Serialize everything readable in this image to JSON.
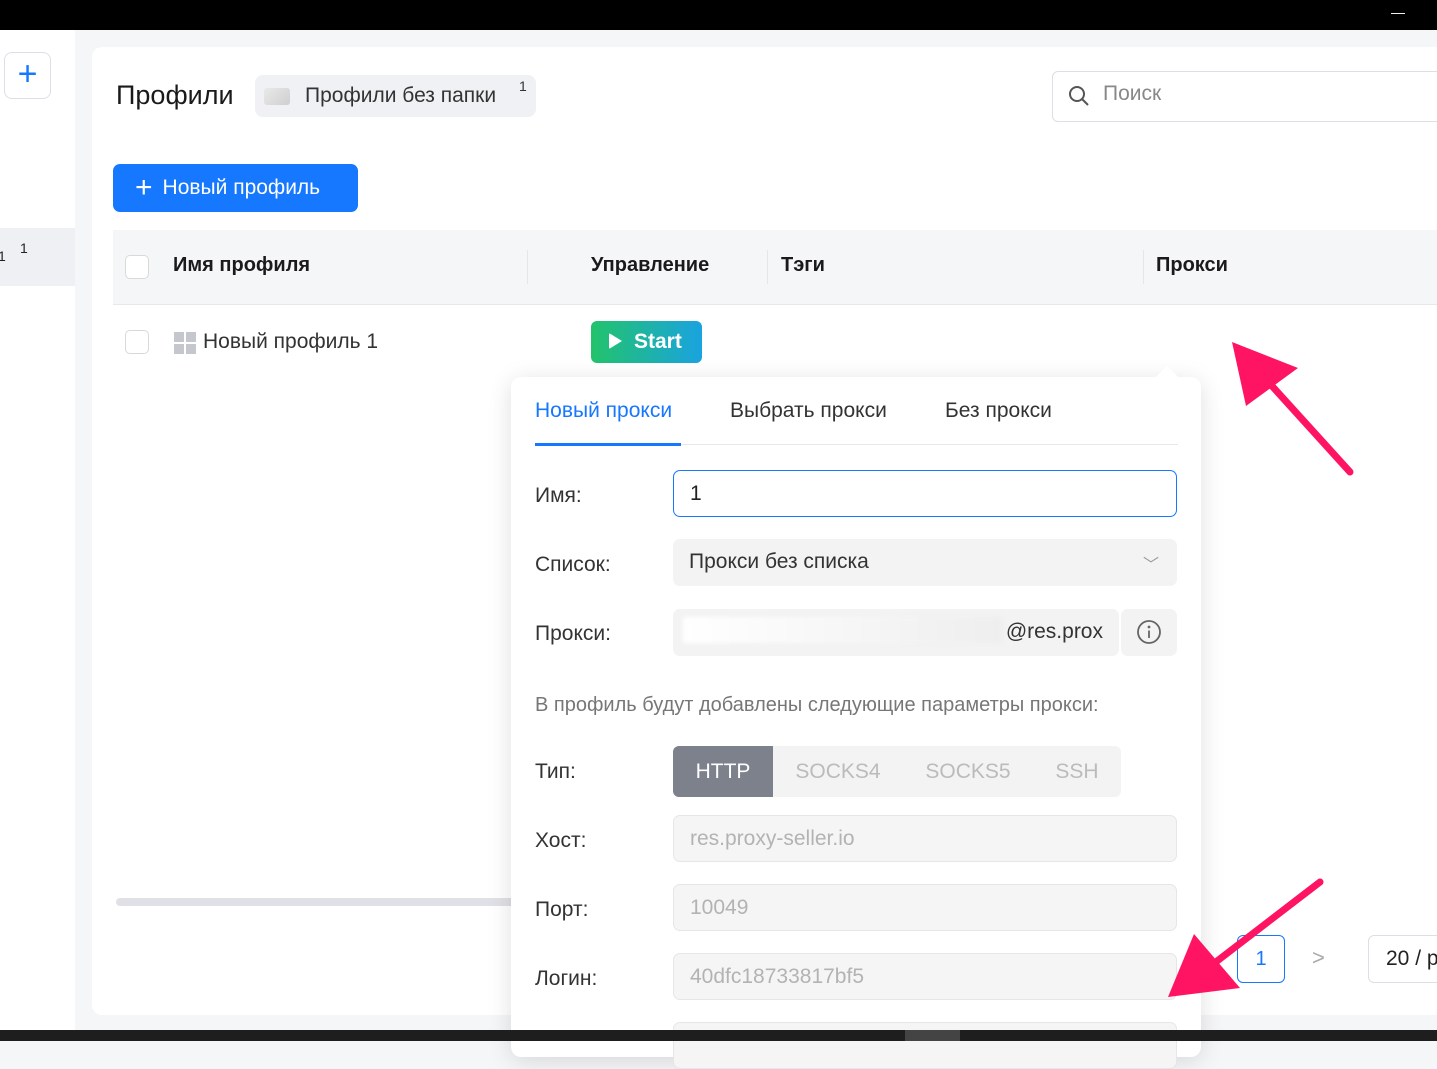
{
  "window": {
    "minimize": "—"
  },
  "sidebar": {
    "add_label": "+",
    "item_label": "1",
    "item_count": "1"
  },
  "header": {
    "title": "Профили",
    "folder": {
      "label": "Профили без папки",
      "count": "1"
    },
    "search_placeholder": "Поиск"
  },
  "toolbar": {
    "new_profile_label": "Новый профиль"
  },
  "table": {
    "columns": [
      "Имя профиля",
      "Управление",
      "Тэги",
      "Прокси"
    ],
    "rows": [
      {
        "name": "Новый профиль 1",
        "action": "Start"
      }
    ]
  },
  "pagination": {
    "current": "1",
    "next": ">",
    "page_size": "20 / p"
  },
  "proxy_popover": {
    "tabs": [
      "Новый прокси",
      "Выбрать прокси",
      "Без прокси"
    ],
    "active_tab": 0,
    "name_label": "Имя:",
    "name_value": "1",
    "list_label": "Список:",
    "list_value": "Прокси без списка",
    "proxy_label": "Прокси:",
    "proxy_value": "@res.prox",
    "hint": "В профиль будут добавлены следующие параметры прокси:",
    "type_label": "Тип:",
    "types": [
      "HTTP",
      "SOCKS4",
      "SOCKS5",
      "SSH"
    ],
    "active_type": "HTTP",
    "host_label": "Хост:",
    "host_value": "res.proxy-seller.io",
    "port_label": "Порт:",
    "port_value": "10049",
    "login_label": "Логин:",
    "login_value": "40dfc18733817bf5"
  },
  "colors": {
    "accent": "#1677ff",
    "annotation": "#ff1464",
    "start_green": "#22c36b"
  }
}
